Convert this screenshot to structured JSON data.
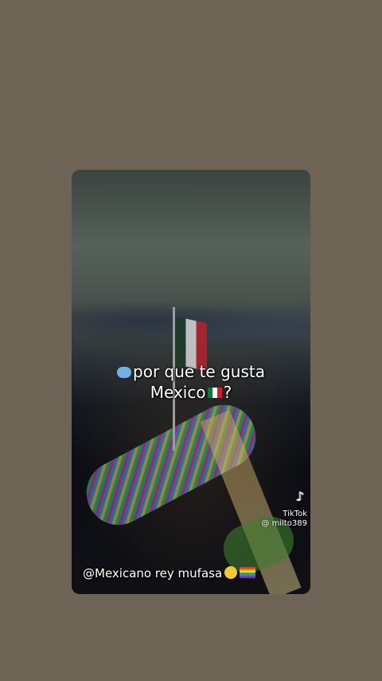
{
  "video": {
    "caption_line1": "por que te gusta",
    "caption_line2": "Mexico",
    "caption_end": "?",
    "watermark_brand": "TikTok",
    "watermark_user": "@ milto389",
    "handle_text": "@Mexicano rey mufasa",
    "icons": [
      "speech-bubble-icon",
      "mexico-flag-icon",
      "tiktok-logo-icon",
      "pleading-face-icon",
      "rainbow-flag-icon"
    ]
  },
  "colors": {
    "background": "#6e6456",
    "text": "#ffffff"
  }
}
